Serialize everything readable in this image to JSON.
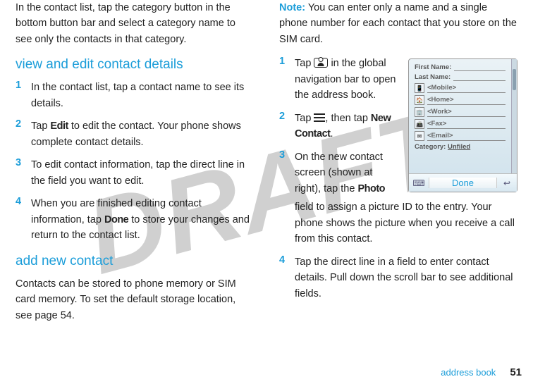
{
  "watermark": "DRAFT",
  "left": {
    "intro": "In the contact list, tap the category button in the bottom button bar and select a category name to see only the contacts in that category.",
    "heading1": "view and edit contact details",
    "steps1": [
      {
        "n": "1",
        "text_a": "In the contact list, tap a contact name to see its details."
      },
      {
        "n": "2",
        "text_a": "Tap ",
        "bold1": "Edit",
        "text_b": " to edit the contact. Your phone shows complete contact details."
      },
      {
        "n": "3",
        "text_a": "To edit contact information, tap the direct line in the field you want to edit."
      },
      {
        "n": "4",
        "text_a": "When you are finished editing contact information, tap ",
        "bold1": "Done",
        "text_b": " to store your changes and return to the contact list."
      }
    ],
    "heading2": "add new contact",
    "para2": "Contacts can be stored to phone memory or SIM card memory. To set the default storage location, see page 54."
  },
  "right": {
    "note_label": "Note:",
    "note_text": " You can enter only a name and a single phone number for each contact that you store on the SIM card.",
    "steps": [
      {
        "n": "1",
        "pre": "Tap ",
        "post": " in the global navigation bar to open the address book."
      },
      {
        "n": "2",
        "pre": "Tap ",
        "mid": ", then tap ",
        "bold": "New Contact",
        "post2": "."
      },
      {
        "n": "3",
        "pre": "On the new contact screen (shown at right), tap the ",
        "bold": "Photo",
        "post": " field to assign a picture ID to the entry. Your phone shows the picture when you receive a call from this contact."
      },
      {
        "n": "4",
        "pre": "Tap the direct line in a field to enter contact details. Pull down the scroll bar to see additional fields."
      }
    ]
  },
  "phone": {
    "first_name_label": "First Name:",
    "last_name_label": "Last Name:",
    "fields": [
      "<Mobile>",
      "<Home>",
      "<Work>",
      "<Fax>",
      "<Email>"
    ],
    "category_label": "Category:",
    "category_value": "Unfiled",
    "done": "Done"
  },
  "footer": {
    "section": "address book",
    "page": "51"
  }
}
